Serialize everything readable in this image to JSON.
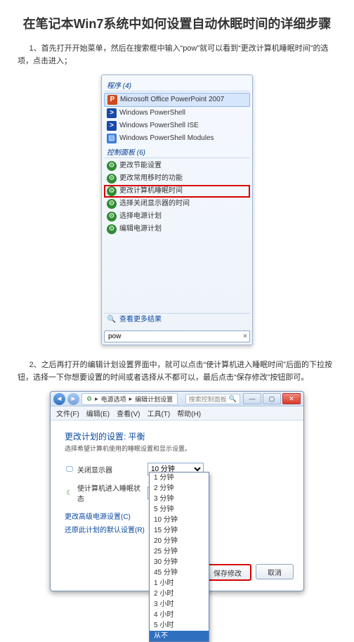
{
  "title": "在笔记本Win7系统中如何设置自动休眠时间的详细步骤",
  "step1": "1、首先打开开始菜单，然后在搜索框中输入“pow”就可以看到“更改计算机睡眠时间”的选项，点击进入；",
  "step2": "2、之后再打开的编辑计划设置界面中，就可以点击“使计算机进入睡眠时间”后面的下拉按钮，选择一下你想要设置的时间或者选择从不都可以，最后点击“保存修改”按钮即可。",
  "start": {
    "sect_programs": "程序 (4)",
    "programs": [
      {
        "icon": "pp",
        "label": "Microsoft Office PowerPoint 2007"
      },
      {
        "icon": "ps",
        "label": "Windows PowerShell"
      },
      {
        "icon": "ps",
        "label": "Windows PowerShell ISE"
      },
      {
        "icon": "mod",
        "label": "Windows PowerShell Modules"
      }
    ],
    "sect_cp": "控制面板 (6)",
    "cp_items": [
      "更改节能设置",
      "更改常用移时的功能",
      "更改计算机睡眠时间",
      "选择关闭显示器的时间",
      "选择电源计划",
      "编辑电源计划"
    ],
    "cp_highlight_index": 2,
    "more": "查看更多结果",
    "search_value": "pow"
  },
  "dlg": {
    "breadcrumb_sep": "▸",
    "breadcrumb_1": "电源选项",
    "breadcrumb_2": "编辑计划设置",
    "search_placeholder": "搜索控制面板",
    "menus": [
      "文件(F)",
      "编辑(E)",
      "查看(V)",
      "工具(T)",
      "帮助(H)"
    ],
    "plan_title": "更改计划的设置: 平衡",
    "plan_sub": "选择希望计算机使用的睡眠设置和显示设置。",
    "field_display": "关闭显示器",
    "field_sleep": "使计算机进入睡眠状态",
    "display_value": "10 分钟",
    "sleep_value": "从不",
    "link1": "更改高级电源设置(C)",
    "link2": "还原此计划的默认设置(R)",
    "options": [
      "1 分钟",
      "2 分钟",
      "3 分钟",
      "5 分钟",
      "10 分钟",
      "15 分钟",
      "20 分钟",
      "25 分钟",
      "30 分钟",
      "45 分钟",
      "1 小时",
      "2 小时",
      "3 小时",
      "4 小时",
      "5 小时",
      "从不"
    ],
    "option_selected_index": 15,
    "btn_save": "保存修改",
    "btn_cancel": "取消"
  }
}
